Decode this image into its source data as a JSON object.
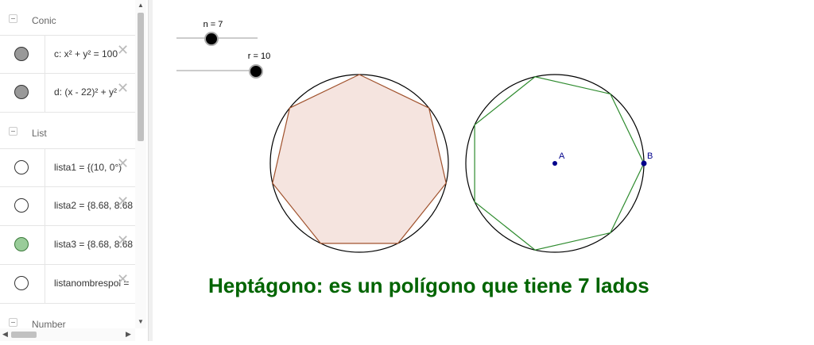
{
  "algebra": {
    "groups": {
      "conic": "Conic",
      "list": "List",
      "number": "Number"
    },
    "rows": [
      {
        "expr": "c: x² + y² = 100",
        "color": "#999999"
      },
      {
        "expr": "d: (x - 22)² + y²",
        "color": "#999999"
      },
      {
        "expr": "lista1 = {(10, 0°)",
        "color": "#ffffff"
      },
      {
        "expr": "lista2 = {8.68, 8.68",
        "color": "#ffffff"
      },
      {
        "expr": "lista3 = {8.68, 8.68",
        "color": "#99cc99"
      },
      {
        "expr": "listanombrespol = ",
        "color": "#ffffff"
      }
    ]
  },
  "sliders": {
    "n_label": "n = 7",
    "n_value": 7,
    "r_label": "r = 10",
    "r_value": 10
  },
  "points": {
    "a": "A",
    "b": "B"
  },
  "caption": "Heptágono: es un polígono que tiene 7 lados",
  "colors": {
    "polygon_fill": "#f5e4df",
    "polygon_stroke": "#a0522d",
    "polyline_stroke": "#2e8b2e",
    "caption": "#006400",
    "point": "#00008b"
  }
}
